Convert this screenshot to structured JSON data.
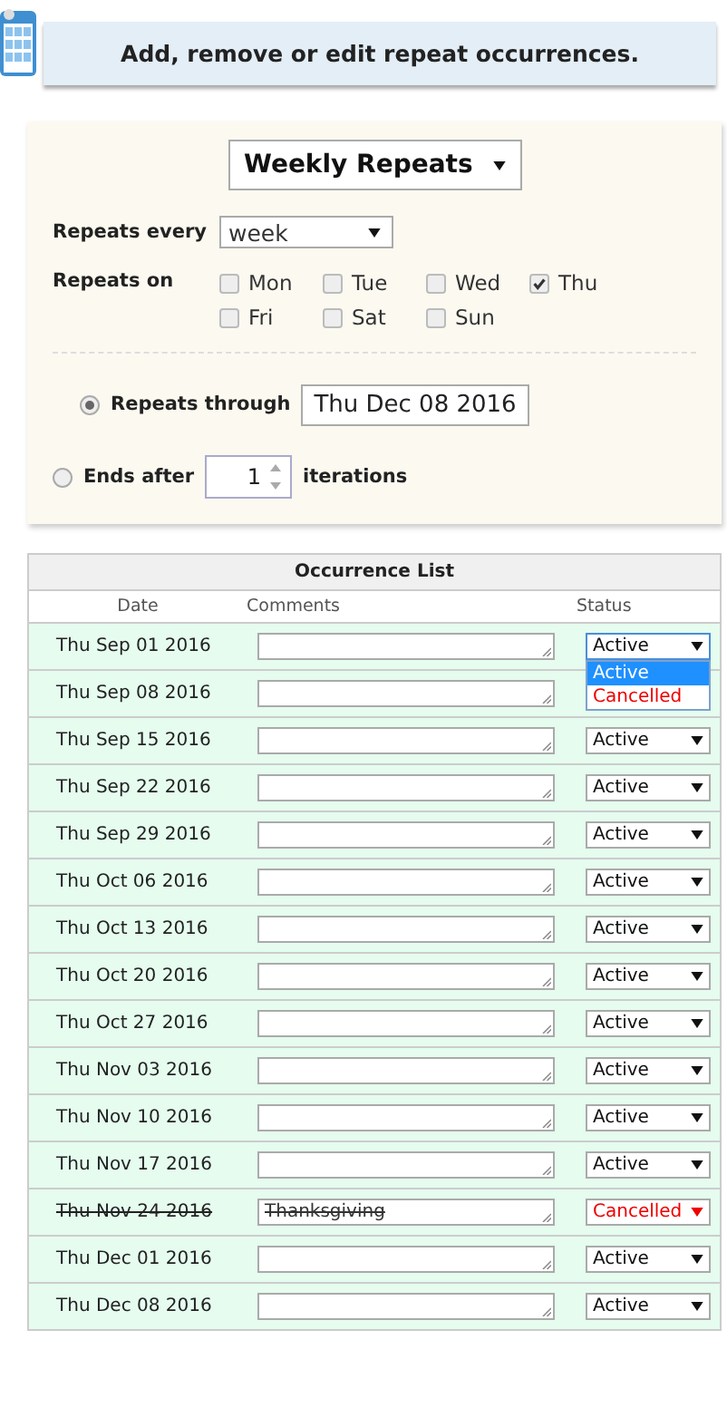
{
  "header": {
    "title": "Add, remove or edit repeat occurrences."
  },
  "repeat_type": {
    "value": "Weekly Repeats"
  },
  "repeats_every": {
    "label": "Repeats every",
    "value": "week"
  },
  "repeats_on": {
    "label": "Repeats on",
    "days": [
      {
        "label": "Mon",
        "checked": false
      },
      {
        "label": "Tue",
        "checked": false
      },
      {
        "label": "Wed",
        "checked": false
      },
      {
        "label": "Thu",
        "checked": true
      },
      {
        "label": "Fri",
        "checked": false
      },
      {
        "label": "Sat",
        "checked": false
      },
      {
        "label": "Sun",
        "checked": false
      }
    ]
  },
  "end_options": [
    {
      "kind": "date",
      "label": "Repeats through",
      "selected": true,
      "value": "Thu Dec 08 2016"
    },
    {
      "kind": "count",
      "label": "Ends after",
      "selected": false,
      "value": "1",
      "suffix": "iterations"
    }
  ],
  "occurrence_list": {
    "title": "Occurrence List",
    "columns": [
      "Date",
      "Comments",
      "Status"
    ],
    "rows": [
      {
        "date": "Thu Sep 01 2016",
        "status": "Active",
        "cancelled": false,
        "open": true,
        "options": [
          {
            "label": "Active",
            "kind": "active",
            "selected": true
          },
          {
            "label": "Cancelled",
            "kind": "cancelled",
            "selected": false
          }
        ]
      },
      {
        "date": "Thu Sep 08 2016",
        "cancelled": false
      },
      {
        "date": "Thu Sep 15 2016",
        "status": "Active",
        "cancelled": false
      },
      {
        "date": "Thu Sep 22 2016",
        "status": "Active",
        "cancelled": false
      },
      {
        "date": "Thu Sep 29 2016",
        "status": "Active",
        "cancelled": false
      },
      {
        "date": "Thu Oct 06 2016",
        "status": "Active",
        "cancelled": false
      },
      {
        "date": "Thu Oct 13 2016",
        "status": "Active",
        "cancelled": false
      },
      {
        "date": "Thu Oct 20 2016",
        "status": "Active",
        "cancelled": false
      },
      {
        "date": "Thu Oct 27 2016",
        "status": "Active",
        "cancelled": false
      },
      {
        "date": "Thu Nov 03 2016",
        "status": "Active",
        "cancelled": false
      },
      {
        "date": "Thu Nov 10 2016",
        "status": "Active",
        "cancelled": false
      },
      {
        "date": "Thu Nov 17 2016",
        "status": "Active",
        "cancelled": false
      },
      {
        "date": "Thu Nov 24 2016",
        "comment": "Thanksgiving",
        "status": "Cancelled",
        "cancelled": true
      },
      {
        "date": "Thu Dec 01 2016",
        "status": "Active",
        "cancelled": false
      },
      {
        "date": "Thu Dec 08 2016",
        "status": "Active",
        "cancelled": false
      }
    ]
  }
}
